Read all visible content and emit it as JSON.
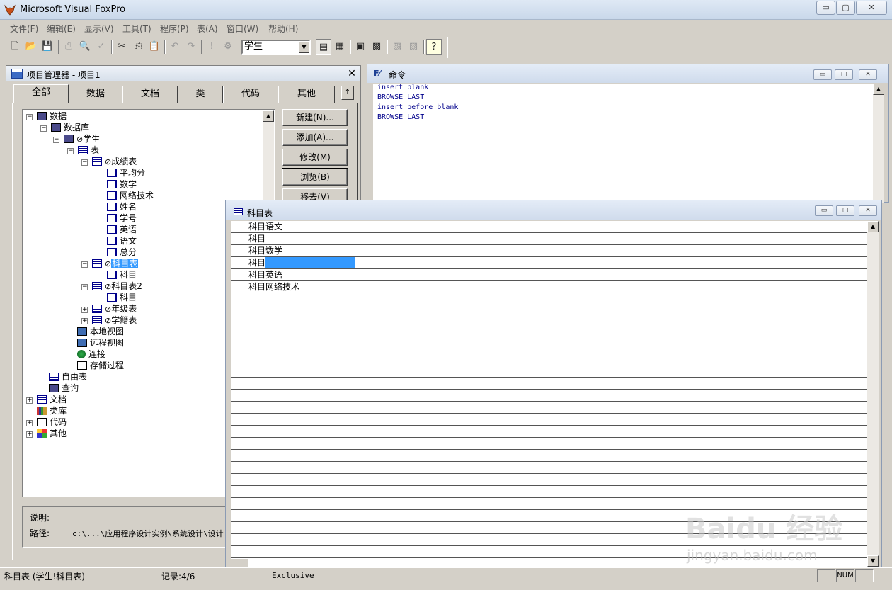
{
  "app": {
    "title": "Microsoft Visual FoxPro"
  },
  "window_controls": {
    "minimize": "▭",
    "maximize": "▢",
    "close": "✕"
  },
  "menu": [
    "文件(F)",
    "编辑(E)",
    "显示(V)",
    "工具(T)",
    "程序(P)",
    "表(A)",
    "窗口(W)",
    "帮助(H)"
  ],
  "toolbar": {
    "database_select": "学生",
    "icons": [
      "new-icon",
      "open-icon",
      "save-icon",
      "print-icon",
      "print-preview-icon",
      "spell-check-icon",
      "cut-icon",
      "copy-icon",
      "paste-icon",
      "undo-icon",
      "redo-icon",
      "run-icon",
      "modify-form-icon",
      "command-window-icon",
      "view-window-icon",
      "form-wizard-icon",
      "report-wizard-icon",
      "autoform-icon",
      "autoreport-icon",
      "help-icon"
    ]
  },
  "project_manager": {
    "title": "项目管理器 - 项目1",
    "tabs": [
      "全部",
      "数据",
      "文档",
      "类",
      "代码",
      "其他"
    ],
    "tab_scroll": "↑",
    "active_tab": "全部",
    "buttons": [
      "新建(N)...",
      "添加(A)...",
      "修改(M)",
      "浏览(B)",
      "移去(V)"
    ],
    "tree": {
      "data": "数据",
      "database": "数据库",
      "db_student": "学生",
      "tables": "表",
      "t_scores": "成绩表",
      "f_avg": "平均分",
      "f_math": "数学",
      "f_net": "网络技术",
      "f_name": "姓名",
      "f_id": "学号",
      "f_english": "英语",
      "f_chinese": "语文",
      "f_total": "总分",
      "t_subject": "科目表",
      "t_subject_field": "科目",
      "t_subject2": "科目表2",
      "t_subject2_field": "科目",
      "t_grade": "年级表",
      "t_origin": "学籍表",
      "local_views": "本地视图",
      "remote_views": "远程视图",
      "connections": "连接",
      "stored_procs": "存储过程",
      "free_tables": "自由表",
      "queries": "查询",
      "docs": "文档",
      "class_libs": "类库",
      "code": "代码",
      "other": "其他",
      "null_mark": "⊘",
      "expand": "+",
      "collapse": "−"
    },
    "info": {
      "desc_label": "说明:",
      "path_label": "路径:",
      "path_value": "c:\\...\\应用程序设计实例\\系统设计\\设计"
    }
  },
  "command_window": {
    "title": "命令",
    "icon": "F⁄",
    "lines": [
      "insert blank",
      "BROWSE LAST",
      "insert before blank",
      "BROWSE LAST"
    ]
  },
  "browse_window": {
    "title": "科目表",
    "rows": [
      "科目语文",
      "科目",
      "科目数学",
      "科目",
      "科目英语",
      "科目网络技术"
    ],
    "selected_row_index": 3
  },
  "statusbar": {
    "table": "科目表 (学生!科目表)",
    "record": "记录:4/6",
    "mode": "Exclusive",
    "num": "NUM"
  },
  "watermark": {
    "main": "Baidu 经验",
    "sub": "jingyan.baidu.com"
  }
}
